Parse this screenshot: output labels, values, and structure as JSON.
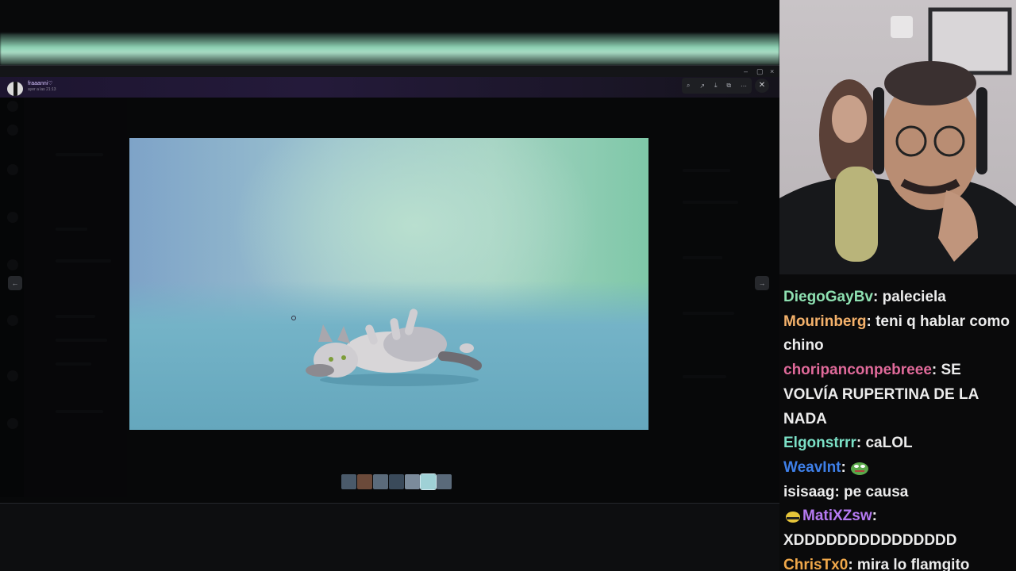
{
  "viewer": {
    "username": "fraaanni♡",
    "timestamp": "ayer a las 21:13"
  },
  "window_controls": {
    "minimize": "–",
    "maximize": "▢",
    "close": "×"
  },
  "toolbar": {
    "zoom_icon": "⌕",
    "forward_icon": "↗",
    "download_icon": "⤓",
    "open_icon": "⧉",
    "more_icon": "⋯",
    "close_icon": "✕"
  },
  "nav": {
    "prev": "←",
    "next": "→"
  },
  "thumbnails": [
    "#4a5a6a",
    "#6b4a3a",
    "#5b6b7b",
    "#3a4a5a",
    "#7b8b9b",
    "#9fd1d6",
    "#5a6a7a"
  ],
  "chat": {
    "messages": [
      {
        "user": "DiegoGayBv",
        "color": "#8ee0b1",
        "text": "paleciela"
      },
      {
        "user": "Mourinberg",
        "color": "#f5b26b",
        "text": "teni q hablar como chino"
      },
      {
        "user": "choripanconpebreee",
        "color": "#e06a9a",
        "text": "SE VOLVÍA RUPERTINA DE LA NADA"
      },
      {
        "user": "Elgonstrrr",
        "color": "#7be0c6",
        "text": "caLOL"
      },
      {
        "user": "WeavInt",
        "color": "#3e7fe8",
        "text": "",
        "emote": "pepe"
      },
      {
        "user": "isisaag",
        "color": "#ececec",
        "text": "pe causa"
      },
      {
        "user": "MatiXZsw",
        "color": "#b57af2",
        "text": "XDDDDDDDDDDDDDDD",
        "badge": "badge"
      },
      {
        "user": "ChrisTx0",
        "color": "#f0a84a",
        "text": "mira lo flamgito"
      }
    ]
  }
}
